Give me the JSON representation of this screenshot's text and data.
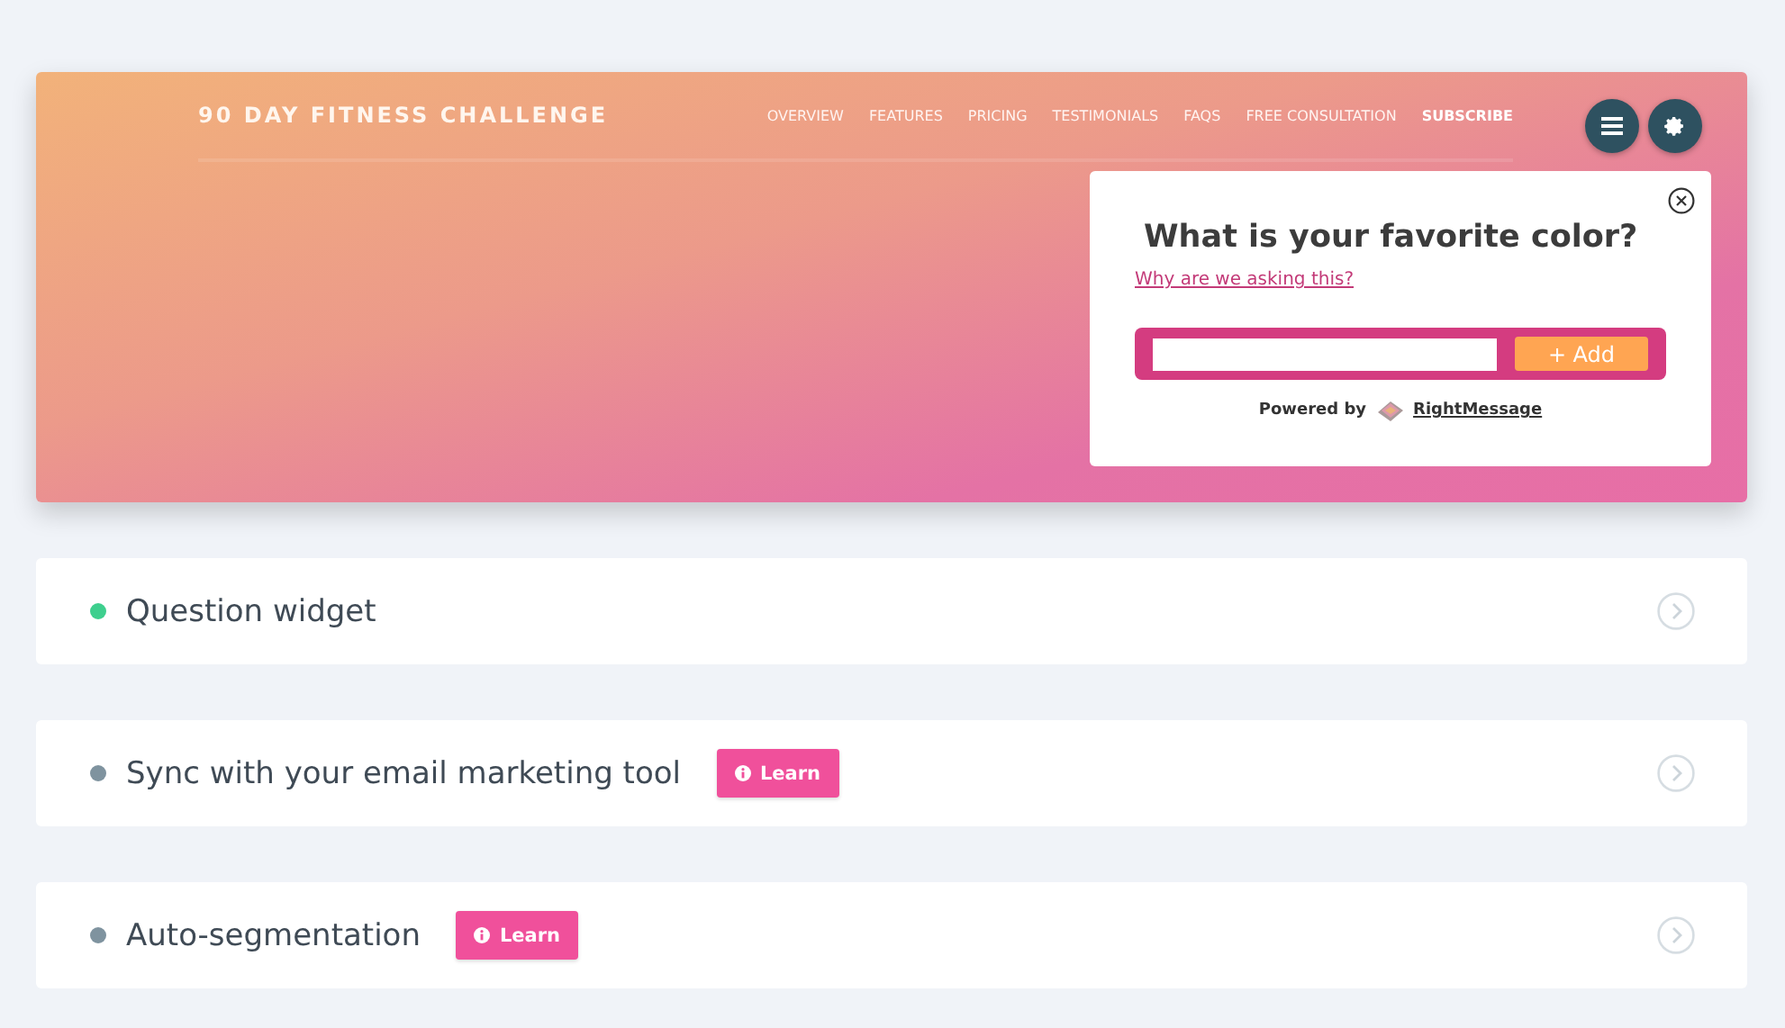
{
  "preview": {
    "site_title": "90 DAY FITNESS CHALLENGE",
    "nav": [
      "OVERVIEW",
      "FEATURES",
      "PRICING",
      "TESTIMONIALS",
      "FAQS",
      "FREE CONSULTATION",
      "SUBSCRIBE"
    ],
    "popup": {
      "question": "What is your favorite color?",
      "why_link": "Why are we asking this?",
      "add_button": "+ Add",
      "powered_by": "Powered by",
      "brand": "RightMessage"
    }
  },
  "items": [
    {
      "title": "Question widget",
      "color": "#3ecf8e"
    },
    {
      "title": "Sync with your email marketing tool",
      "color": "#7f939f",
      "learn": "Learn"
    },
    {
      "title": "Auto-segmentation",
      "color": "#7f939f",
      "learn": "Learn"
    }
  ]
}
